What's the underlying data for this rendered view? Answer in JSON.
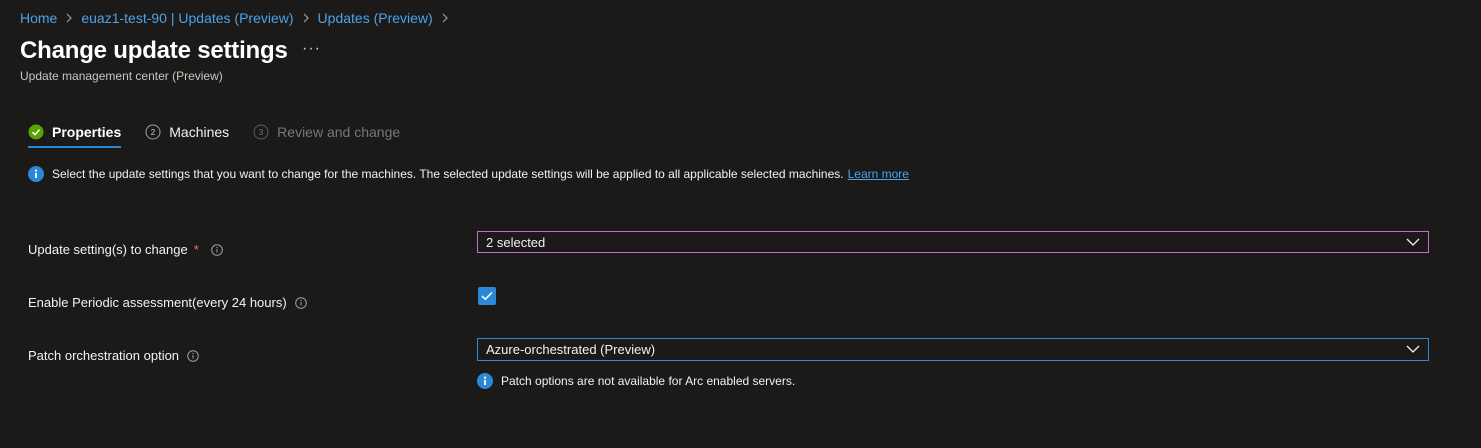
{
  "breadcrumb": {
    "items": [
      "Home",
      "euaz1-test-90 | Updates (Preview)",
      "Updates (Preview)"
    ]
  },
  "header": {
    "title": "Change update settings",
    "more": "···",
    "subtitle": "Update management center (Preview)"
  },
  "tabs": [
    {
      "label": "Properties",
      "step": "✓",
      "state": "complete"
    },
    {
      "label": "Machines",
      "step": "2",
      "state": "enabled"
    },
    {
      "label": "Review and change",
      "step": "3",
      "state": "disabled"
    }
  ],
  "info": {
    "text": "Select the update settings that you want to change for the machines. The selected update settings will be applied to all applicable selected machines.",
    "link": "Learn more"
  },
  "form": {
    "update_settings_label": "Update setting(s) to change",
    "required_mark": "*",
    "update_settings_value": "2 selected",
    "periodic_label": "Enable Periodic assessment(every 24 hours)",
    "periodic_checked": true,
    "patch_label": "Patch orchestration option",
    "patch_value": "Azure-orchestrated (Preview)",
    "patch_note": "Patch options are not available for Arc enabled servers."
  },
  "colors": {
    "accent": "#2b88d8",
    "success": "#57a300",
    "focus_border": "#c56bd6",
    "required": "#f1707b",
    "info": "#2b88d8"
  },
  "icons": {
    "info": "info-icon",
    "check": "checkmark-icon",
    "chevron": "chevron-down-icon",
    "tooltip": "info-outline-icon"
  }
}
